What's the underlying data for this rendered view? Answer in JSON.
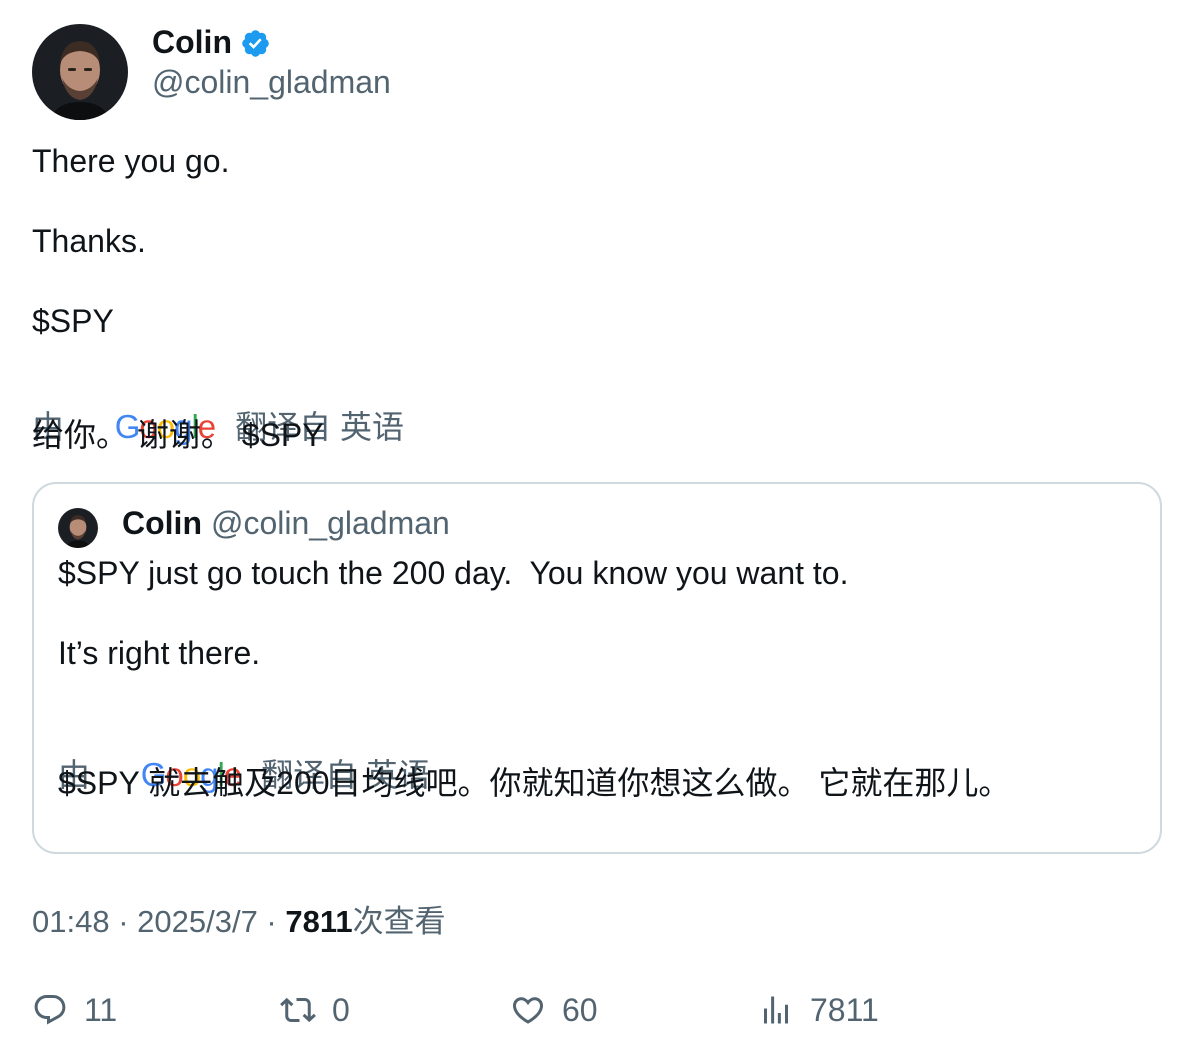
{
  "author": {
    "name": "Colin",
    "handle": "@colin_gladman",
    "verified_badge_icon": "verified-check-icon",
    "badge_color": "#1d9bf0"
  },
  "tweet": {
    "line1": "There you go.",
    "line2": "Thanks.",
    "line3": "$SPY",
    "translation_prefix": "由",
    "translation_suffix": "翻译自 英语",
    "translated_text": "给你。 谢谢。 $SPY"
  },
  "quoted": {
    "name": "Colin",
    "handle": "@colin_gladman",
    "line1": "$SPY just go touch the 200 day.  You know you want to.",
    "line2": "It’s right there.",
    "translation_prefix": "由",
    "translation_suffix": "翻译自 英语",
    "translated_text": "$SPY 就去触及200日均线吧。你就知道你想这么做。 它就在那儿。"
  },
  "meta": {
    "time": "01:48",
    "date": "2025/3/7",
    "views": "7811",
    "views_label": "次查看"
  },
  "actions": {
    "replies": "11",
    "retweets": "0",
    "likes": "60",
    "views": "7811"
  },
  "google_logo": {
    "letters": [
      "G",
      "o",
      "o",
      "g",
      "l",
      "e"
    ],
    "colors": [
      "#4285F4",
      "#EA4335",
      "#FBBC05",
      "#4285F4",
      "#34A853",
      "#EA4335"
    ]
  }
}
